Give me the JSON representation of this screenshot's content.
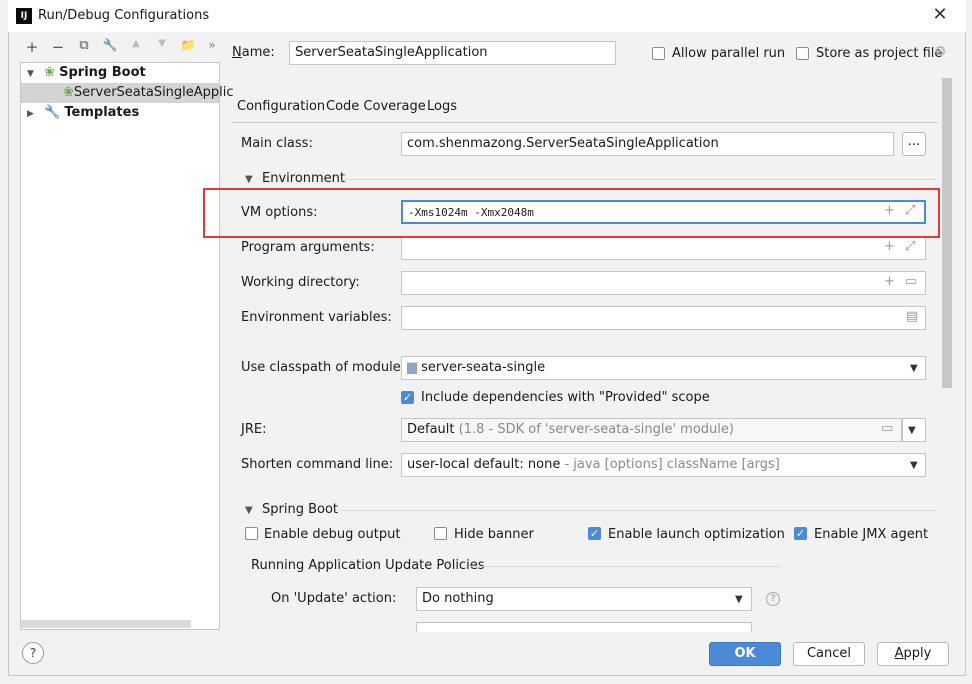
{
  "window": {
    "title": "Run/Debug Configurations",
    "app_icon": "intellij-logo"
  },
  "toolbar": {
    "add": "+",
    "remove": "−",
    "copy": "⧉",
    "edit": "🔧",
    "up": "▲",
    "down": "▼",
    "folder": "📁",
    "more": "»"
  },
  "tree": {
    "spring_boot": "Spring Boot",
    "app_item": "ServerSeataSingleApplic",
    "templates": "Templates"
  },
  "header": {
    "name_label": "Name:",
    "name_value": "ServerSeataSingleApplication",
    "allow_parallel": "Allow parallel run",
    "store_project": "Store as project file"
  },
  "tabs": [
    "Configuration",
    "Code Coverage",
    "Logs"
  ],
  "config": {
    "main_class_label": "Main class:",
    "main_class_value": "com.shenmazong.ServerSeataSingleApplication",
    "browse": "...",
    "environment": "Environment",
    "vm_label": "VM options:",
    "vm_value": "-Xms1024m -Xmx2048m",
    "program_args_label": "Program arguments:",
    "working_dir_label": "Working directory:",
    "env_vars_label": "Environment variables:",
    "classpath_label": "Use classpath of module:",
    "classpath_value": "server-seata-single",
    "include_deps": "Include dependencies with \"Provided\" scope",
    "jre_label": "JRE:",
    "jre_value": "Default",
    "jre_hint": " (1.8 - SDK of 'server-seata-single' module)",
    "shorten_label": "Shorten command line:",
    "shorten_value": "user-local default: none",
    "shorten_hint": " - java [options] className [args]",
    "spring_boot": "Spring Boot",
    "debug_output": "Enable debug output",
    "hide_banner": "Hide banner",
    "launch_opt": "Enable launch optimization",
    "jmx_agent": "Enable JMX agent",
    "policies": "Running Application Update Policies",
    "on_update_label": "On 'Update' action:",
    "on_update_value": "Do nothing"
  },
  "footer": {
    "help": "?",
    "ok": "OK",
    "cancel": "Cancel",
    "apply": "Apply"
  }
}
